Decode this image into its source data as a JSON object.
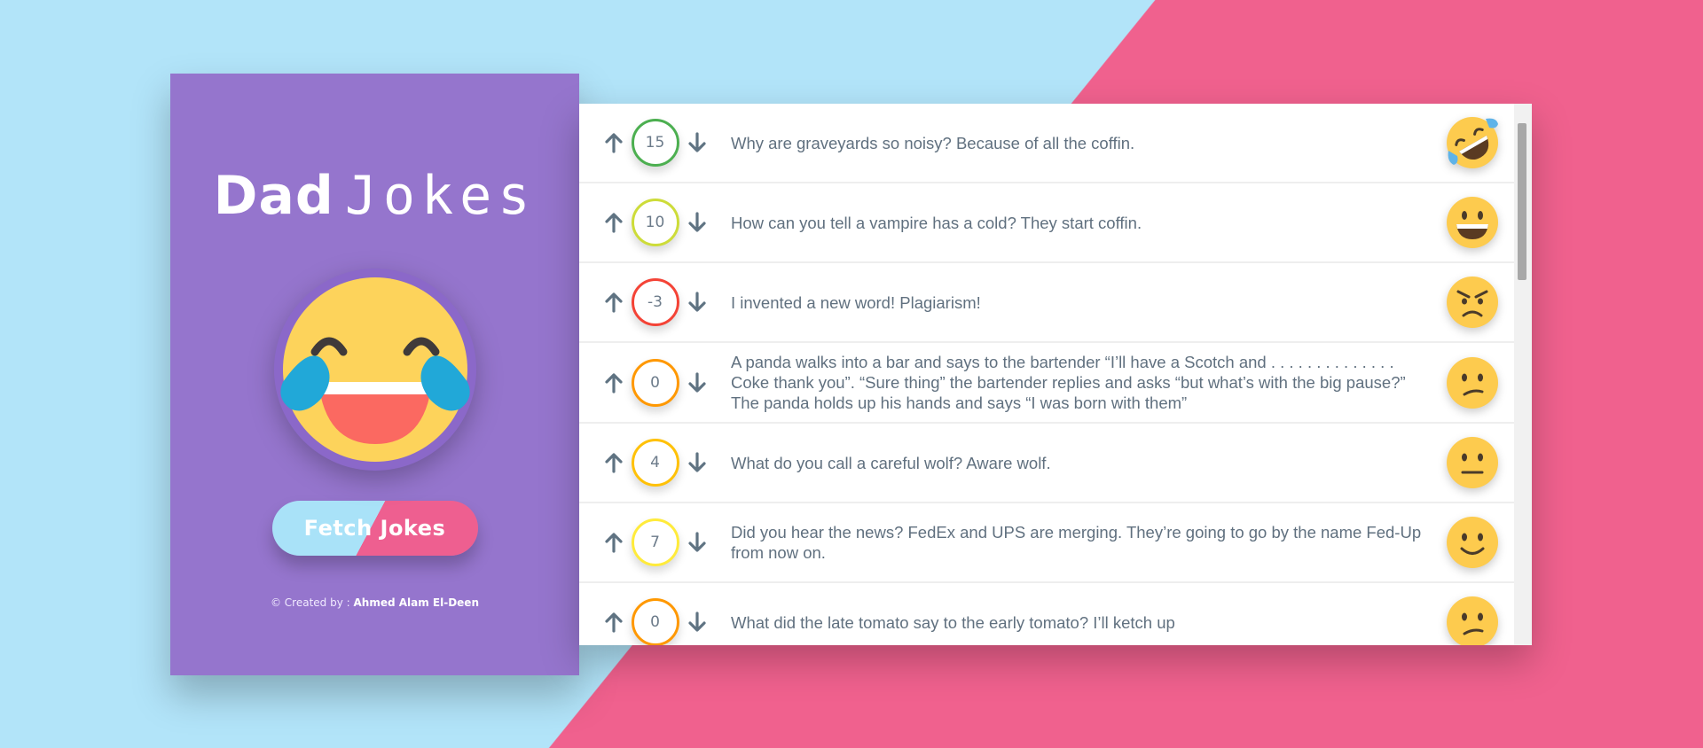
{
  "sidebar": {
    "title_bold": "Dad",
    "title_light": "Jokes",
    "fetch_label": "Fetch Jokes",
    "credit_prefix": "© Created by : ",
    "credit_name": "Ahmed Alam El-Deen"
  },
  "colors": {
    "purple": "#9575cd",
    "pink": "#f0618e",
    "sky": "#b2e4f9",
    "score_green": "#4caf50",
    "score_lime": "#cddc39",
    "score_red": "#f44336",
    "score_orange": "#ff9800",
    "score_amber": "#ffc107",
    "score_yellow": "#ffeb3b"
  },
  "jokes": [
    {
      "votes": "15",
      "text": "Why are graveyards so noisy? Because of all the coffin.",
      "emoji": "rolling-laughing-icon"
    },
    {
      "votes": "10",
      "text": "How can you tell a vampire has a cold? They start coffin.",
      "emoji": "grinning-icon"
    },
    {
      "votes": "-3",
      "text": "I invented a new word! Plagiarism!",
      "emoji": "angry-icon"
    },
    {
      "votes": "0",
      "text": "A panda walks into a bar and says to the bartender “I’ll have a Scotch and . . . . . . . . . . . . . . Coke thank you”.   “Sure thing” the bartender replies and asks “but what’s with the big pause?”   The panda holds up his hands and says “I was born with them”",
      "emoji": "confused-icon"
    },
    {
      "votes": "4",
      "text": "What do you call a careful wolf? Aware wolf.",
      "emoji": "neutral-icon"
    },
    {
      "votes": "7",
      "text": "Did you hear the news? FedEx and UPS are merging. They’re going to go by the name Fed-Up from now on.",
      "emoji": "slight-smile-icon"
    },
    {
      "votes": "0",
      "text": "What did the late tomato say to the early tomato? I’ll ketch up",
      "emoji": "confused-icon"
    }
  ]
}
